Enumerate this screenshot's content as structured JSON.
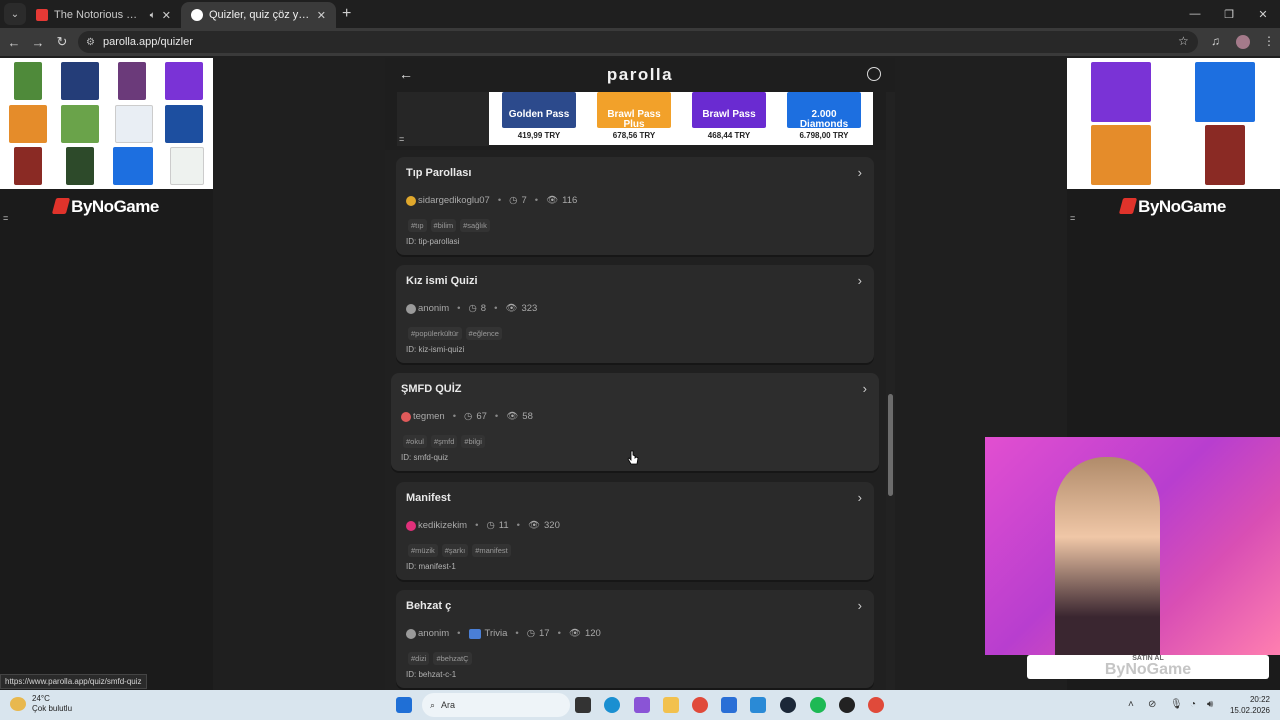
{
  "browser": {
    "tabs": [
      {
        "title": "The Notorious B.I.G. - Suicid",
        "active": false,
        "favicon_color": "#e53935"
      },
      {
        "title": "Quizler, quiz çöz ya da quiz olu",
        "active": true,
        "favicon_color": "#ffffff"
      }
    ],
    "url": "parolla.app/quizler",
    "status_url": "https://www.parolla.app/quiz/smfd-quiz"
  },
  "ads": {
    "brand": "ByNoGame",
    "overlay_label": "SATIN AL",
    "overlay_brand": "ByNoGame"
  },
  "header": {
    "brand": "parolla"
  },
  "banner": {
    "products": [
      {
        "name": "Golden Pass",
        "price": "419,99 TRY",
        "color": "#2c4a8c"
      },
      {
        "name": "Brawl Pass Plus",
        "price": "678,56 TRY",
        "color": "#f2a12a"
      },
      {
        "name": "Brawl Pass",
        "price": "468,44 TRY",
        "color": "#6a2bd1"
      },
      {
        "name": "2.000 Diamonds",
        "price": "6.798,00 TRY",
        "color": "#1d6fe0"
      }
    ]
  },
  "quizzes": [
    {
      "title": "Tıp Parollası",
      "author": "sidargedikoglu07",
      "avatar_color": "#e0a82c",
      "questions": "7",
      "views": "116",
      "category": "",
      "tags": [
        "#tıp",
        "#bilim",
        "#sağlık"
      ],
      "id": "ID: tip-parollasi"
    },
    {
      "title": "Kız ismi Quizi",
      "author": "anonim",
      "avatar_color": "#9a9a9a",
      "questions": "8",
      "views": "323",
      "category": "",
      "tags": [
        "#popülerkültür",
        "#eğlence"
      ],
      "id": "ID: kiz-ismi-quizi"
    },
    {
      "title": "ŞMFD QUİZ",
      "author": "tegmen",
      "avatar_color": "#e05a5a",
      "questions": "67",
      "views": "58",
      "category": "",
      "tags": [
        "#okul",
        "#şmfd",
        "#bilgi"
      ],
      "id": "ID: smfd-quiz"
    },
    {
      "title": "Manifest",
      "author": "kedikizekim",
      "avatar_color": "#e0307a",
      "questions": "11",
      "views": "320",
      "category": "",
      "tags": [
        "#müzik",
        "#şarkı",
        "#manifest"
      ],
      "id": "ID: manifest-1"
    },
    {
      "title": "Behzat ç",
      "author": "anonim",
      "avatar_color": "#9a9a9a",
      "questions": "17",
      "views": "120",
      "category": "Trivia",
      "tags": [
        "#dizi",
        "#behzatÇ"
      ],
      "id": "ID: behzat-c-1"
    }
  ],
  "taskbar": {
    "temp": "24°C",
    "weather": "Çok bulutlu",
    "search": "Ara",
    "time": "20:22",
    "date": "15.02.2026"
  }
}
